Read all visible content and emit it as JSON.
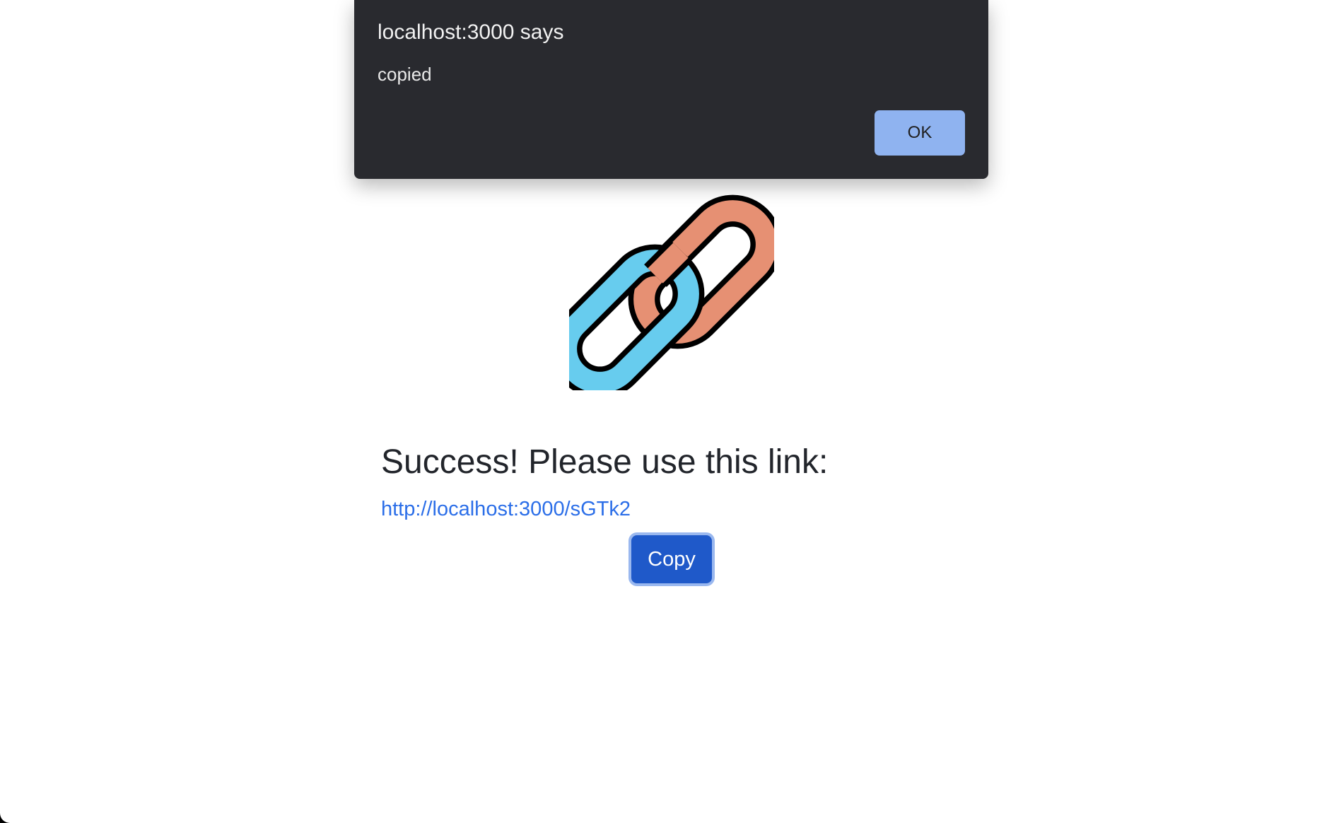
{
  "dialog": {
    "title": "localhost:3000 says",
    "message": "copied",
    "ok_label": "OK"
  },
  "main": {
    "heading": "Success! Please use this link:",
    "link_text": "http://localhost:3000/sGTk2",
    "copy_label": "Copy"
  },
  "icons": {
    "chain": "chain-link-icon"
  },
  "colors": {
    "dialog_bg": "#292a2f",
    "dialog_button": "#8fb3f0",
    "link": "#2b6ee8",
    "copy_button": "#1f59c9",
    "chain_orange": "#e69073",
    "chain_blue": "#67ccee"
  }
}
